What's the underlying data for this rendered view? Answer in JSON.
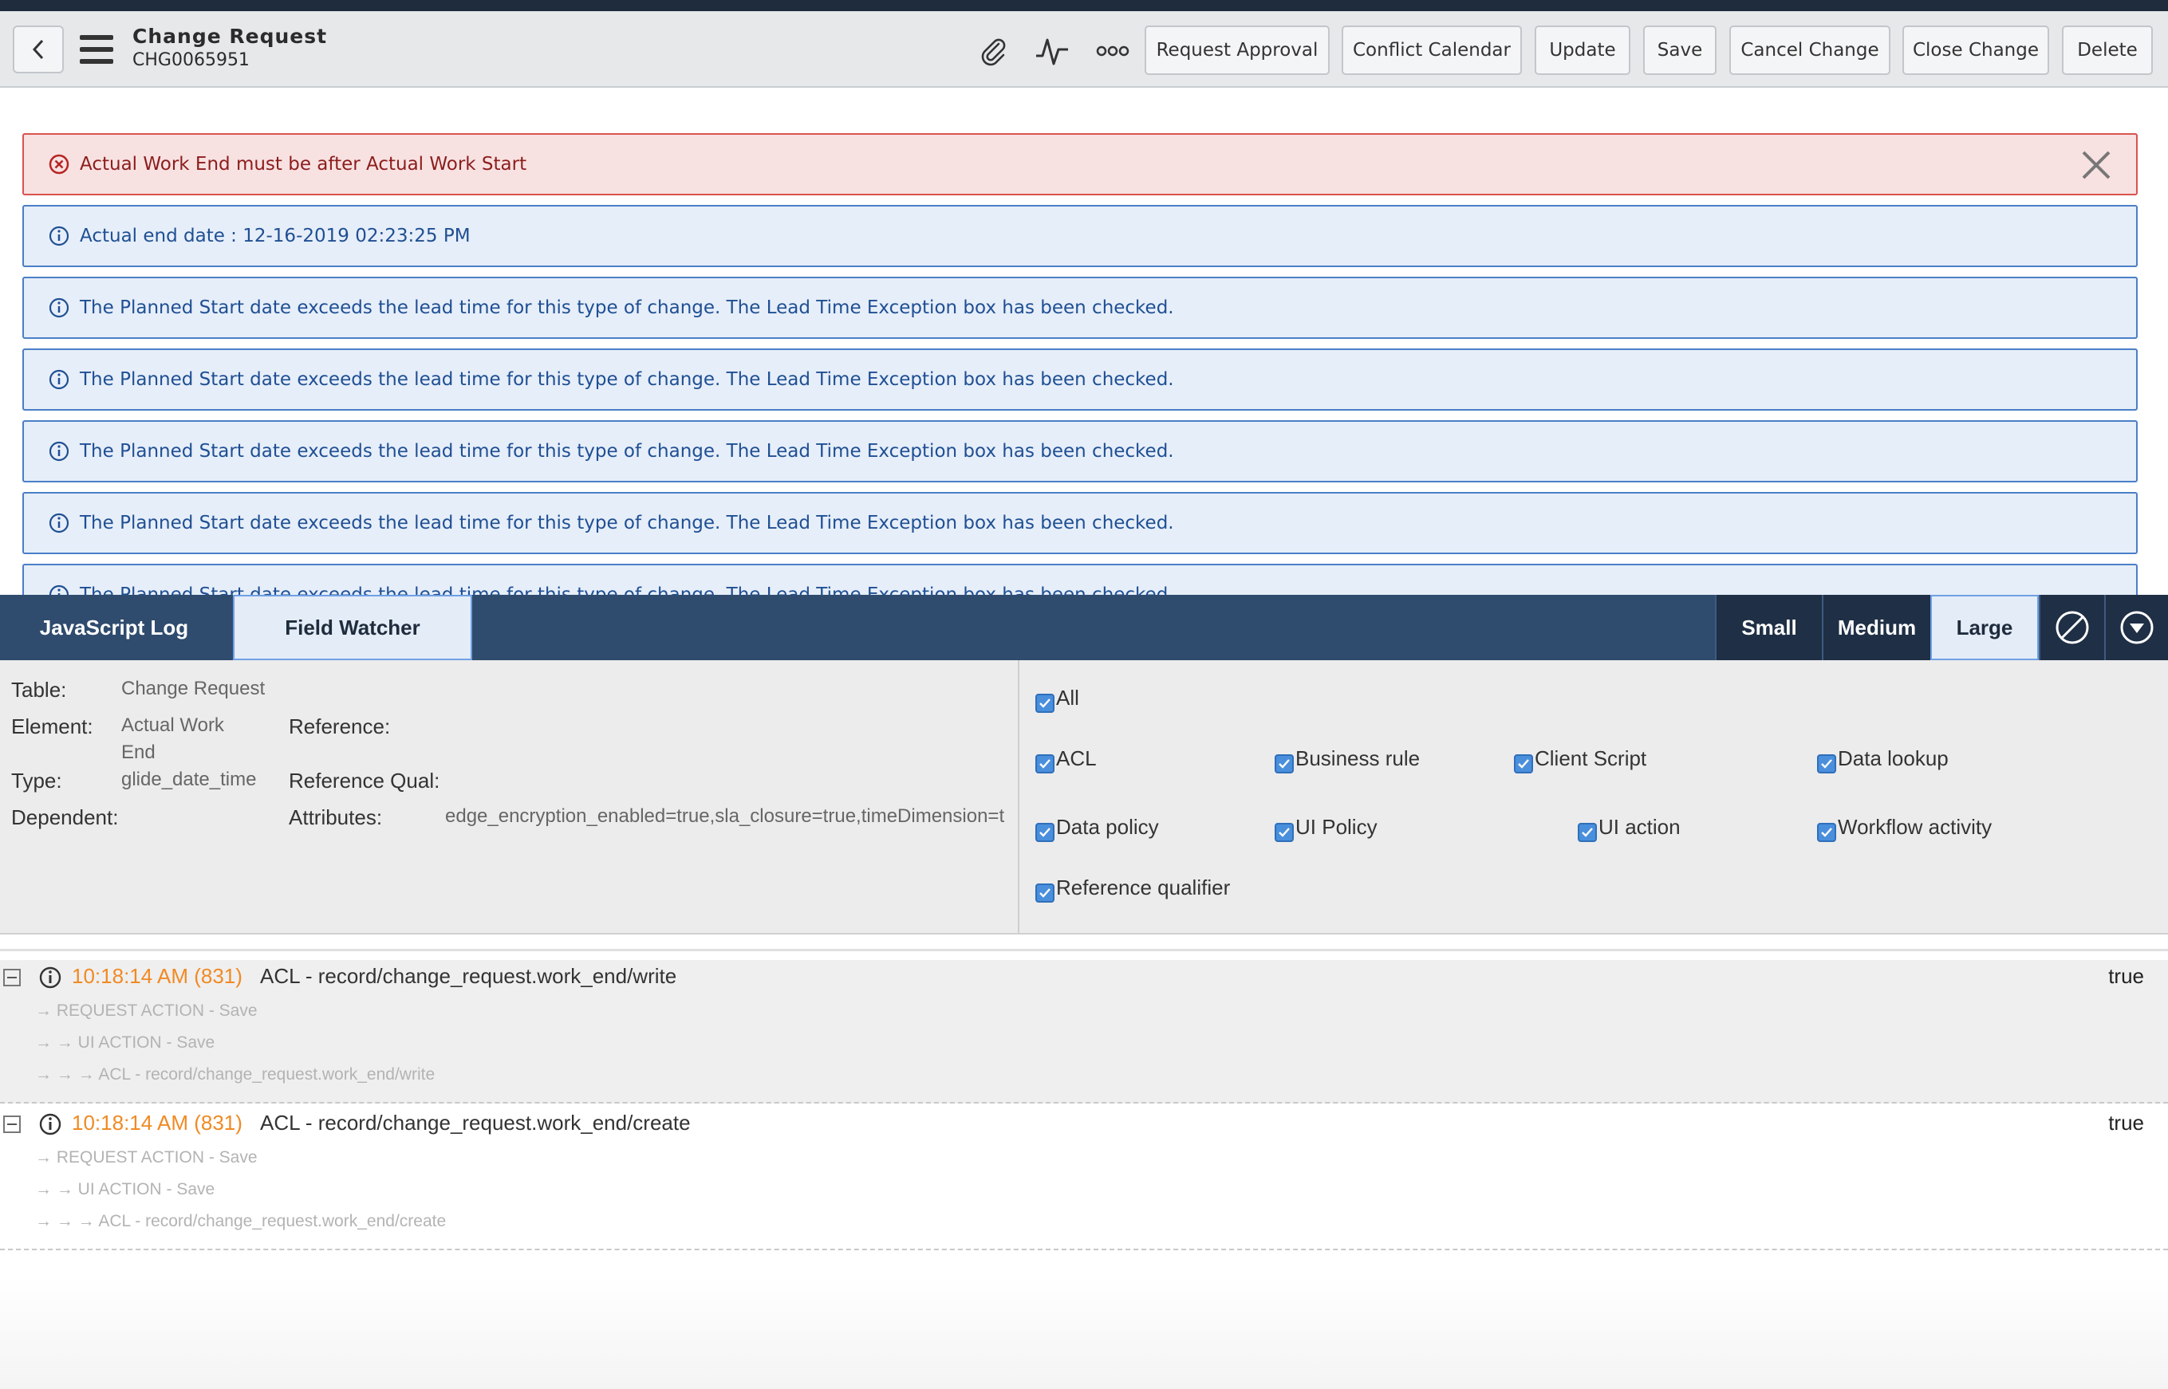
{
  "header": {
    "title": "Change Request",
    "number": "CHG0065951",
    "icons": [
      "back-arrow-icon",
      "hamburger-menu-icon",
      "paperclip-icon",
      "activity-pulse-icon",
      "more-options-icon"
    ],
    "buttons": [
      "Request Approval",
      "Conflict Calendar",
      "Update",
      "Save",
      "Cancel Change",
      "Close Change",
      "Delete"
    ]
  },
  "messages": {
    "error": "Actual Work End must be after Actual Work Start",
    "info": [
      "Actual end date : 12-16-2019 02:23:25 PM",
      "The Planned Start date exceeds the lead time for this type of change. The Lead Time Exception box has been checked.",
      "The Planned Start date exceeds the lead time for this type of change. The Lead Time Exception box has been checked.",
      "The Planned Start date exceeds the lead time for this type of change. The Lead Time Exception box has been checked.",
      "The Planned Start date exceeds the lead time for this type of change. The Lead Time Exception box has been checked.",
      "The Planned Start date exceeds the lead time for this type of change. The Lead Time Exception box has been checked."
    ]
  },
  "debugger": {
    "tabs": [
      "JavaScript Log",
      "Field Watcher"
    ],
    "active_tab": "Field Watcher",
    "sizes": [
      "Small",
      "Medium",
      "Large"
    ],
    "active_size": "Large"
  },
  "field_watcher": {
    "table_label": "Table:",
    "table_value": "Change Request",
    "element_label": "Element:",
    "element_value_line1": "Actual Work",
    "element_value_line2": "End",
    "reference_label": "Reference:",
    "type_label": "Type:",
    "type_value": "glide_date_time",
    "reference_qual_label": "Reference Qual:",
    "dependent_label": "Dependent:",
    "attributes_label": "Attributes:",
    "attributes_value": "edge_encryption_enabled=true,sla_closure=true,timeDimension=t",
    "filters": [
      {
        "label": "All",
        "checked": true
      },
      {
        "label": "ACL",
        "checked": true
      },
      {
        "label": "Business rule",
        "checked": true
      },
      {
        "label": "Client Script",
        "checked": true
      },
      {
        "label": "Data lookup",
        "checked": true
      },
      {
        "label": "Data policy",
        "checked": true
      },
      {
        "label": "UI Policy",
        "checked": true
      },
      {
        "label": "UI action",
        "checked": true
      },
      {
        "label": "Workflow activity",
        "checked": true
      },
      {
        "label": "Reference qualifier",
        "checked": true
      }
    ]
  },
  "log": [
    {
      "time": "10:18:14 AM (831)",
      "message": "ACL - record/change_request.work_end/write",
      "result": "true",
      "trace": [
        "→ REQUEST ACTION - Save",
        "→ → UI ACTION - Save",
        "→ → → ACL - record/change_request.work_end/write"
      ]
    },
    {
      "time": "10:18:14 AM (831)",
      "message": "ACL - record/change_request.work_end/create",
      "result": "true",
      "trace": [
        "→ REQUEST ACTION - Save",
        "→ → UI ACTION - Save",
        "→ → → ACL - record/change_request.work_end/create"
      ]
    }
  ],
  "colors": {
    "debugger_bar": "#2f4b6e",
    "error_bg": "#f8e1e1",
    "info_bg": "#e6eef9",
    "timestamp": "#f08a24",
    "checkbox": "#4a8fdc"
  }
}
